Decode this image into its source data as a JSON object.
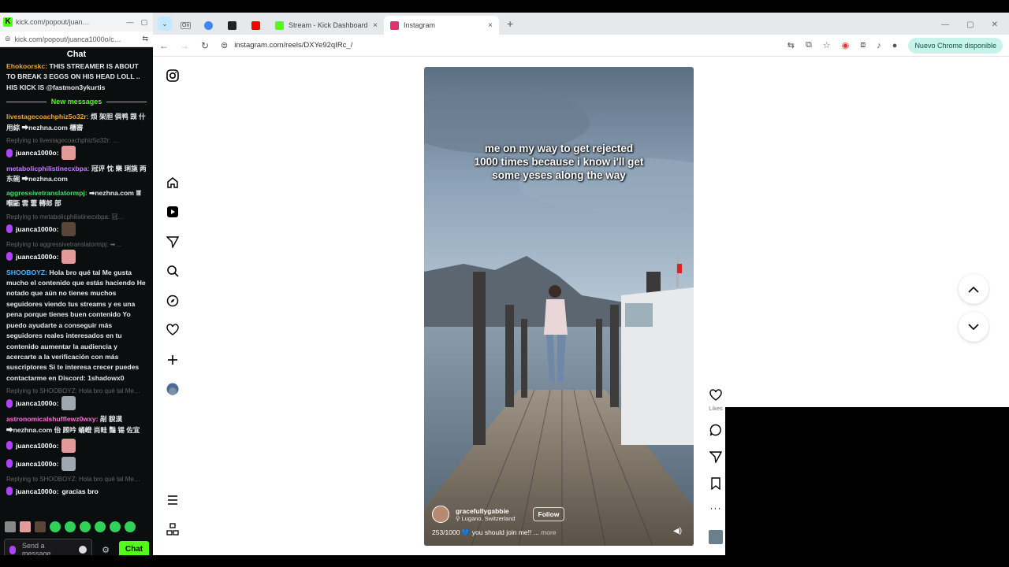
{
  "chat_window": {
    "tab_title": "kick.com/popout/juan…",
    "tab_favicon": "K",
    "address": "kick.com/popout/juanca1000o/c…",
    "header": "Chat",
    "top_message": "THIS STREAMER IS ABOUT TO BREAK 3 EGGS ON HIS HEAD LOLL .. HIS KICK IS @fastmon3ykurtis",
    "top_message_user": "Ehokoorskc:",
    "new_messages_label": "New messages",
    "messages": [
      {
        "user": "livestagecoachphiz5o32r:",
        "user_color": "#f0a52b",
        "text": " 烦 架胆 俱鸭 觊 什 用綜 ➡nezhna.com 櫃審"
      },
      {
        "reply": "Replying to livestagecoachphiz5o32r: …",
        "self": "juanca1000o:"
      },
      {
        "user": "metabolicphilistinecxbpa:",
        "user_color": "#c77dff",
        "text": " 冠评 忱 樂 琍旐 两 东碗 ➡nezhna.com"
      },
      {
        "user": "aggressivetranslatormpj:",
        "user_color": "#39e26a",
        "text": " ➡nezhna.com 𝍱 嗰鼫 雲 蕓 轉郎 部"
      },
      {
        "reply": "Replying to metabolicphilistinecxbpa: 冠…",
        "self": "juanca1000o:"
      },
      {
        "reply": "Replying to aggressivetranslatormpj: ➡…",
        "self": "juanca1000o:"
      },
      {
        "user": "SHOOBOYZ:",
        "user_color": "#4fb3ff",
        "text": " Hola bro qué tal Me gusta mucho el contenido que estás haciendo He notado que aún no tienes muchos seguidores viendo tus streams y es una pena porque tienes buen contenido Yo puedo ayudarte a conseguir más seguidores reales interesados en tu contenido aumentar la audiencia y acercarte a la verificación con más suscriptores Si te interesa crecer puedes contactarme en Discord: 1shadowx0"
      },
      {
        "reply": "Replying to SHOOBOYZ: Hola bro qué tal Me…",
        "self": "juanca1000o:"
      },
      {
        "user": "astronomicalshufflewz0wxy:",
        "user_color": "#ff6bd6",
        "text": " 剐 貌漠 ➡nezhna.com 佁 顾吟 蛹嶝 尚畦 豔 锡 佐宜"
      },
      {
        "self": "juanca1000o:"
      },
      {
        "self": "juanca1000o:"
      },
      {
        "reply": "Replying to SHOOBOYZ: Hola bro qué tal Me…",
        "self": "juanca1000o:",
        "self_text": " gracias bro"
      }
    ],
    "send_placeholder": "Send a message",
    "chat_button": "Chat"
  },
  "browser": {
    "tabs": [
      {
        "label": "On",
        "favicon_color": "#888888"
      },
      {
        "label": "",
        "favicon_color": "#4285f4"
      },
      {
        "label": "",
        "favicon_color": "#222222"
      },
      {
        "label": "",
        "favicon_color": "#ff0000"
      },
      {
        "label": "Stream - Kick Dashboard",
        "favicon_color": "#53fc18"
      },
      {
        "label": "Instagram",
        "favicon_color": "#e1306c"
      }
    ],
    "address": "instagram.com/reels/DXYe92qIRc_/",
    "update_badge": "Nuevo Chrome disponible"
  },
  "reel": {
    "overlay_text_1": "me on my way to get rejected",
    "overlay_text_2": "1000 times because i know i'll get",
    "overlay_text_3": "some yeses along the way",
    "username": "gracefullygabbie",
    "location": "Lugano, Switzerland",
    "follow_label": "Follow",
    "caption": "253/1000 💙 you should join me!! ...",
    "caption_more": "more",
    "likes_label": "Likes"
  },
  "colors": {
    "kick_green": "#53fc18",
    "ig_accent": "#e1306c"
  }
}
